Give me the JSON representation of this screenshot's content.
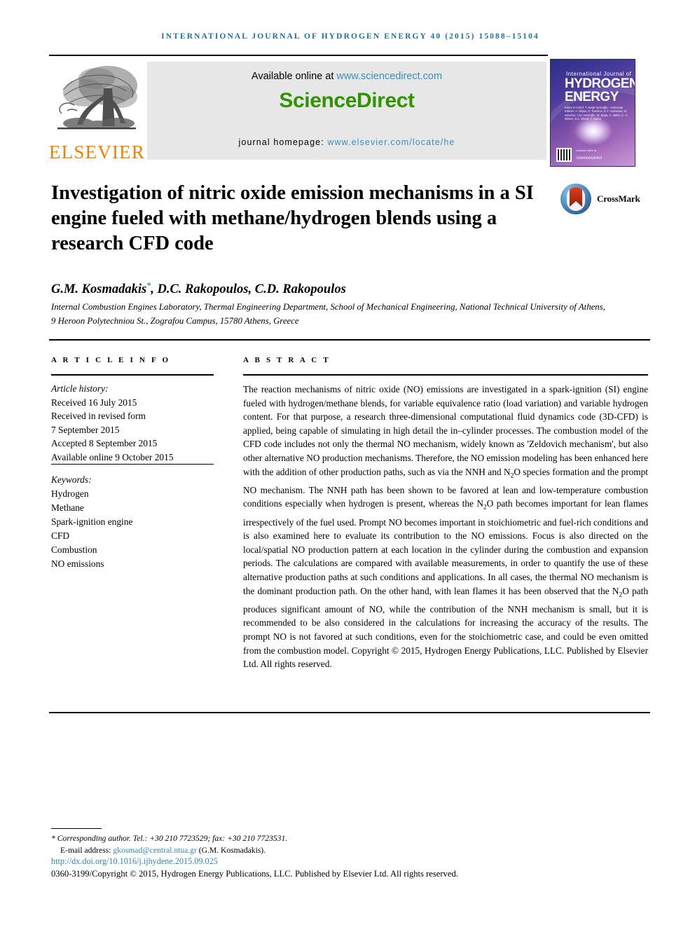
{
  "running_head": "International Journal of Hydrogen Energy 40 (2015) 15088–15104",
  "masthead": {
    "publisher_wordmark": "ELSEVIER",
    "available_prefix": "Available online at ",
    "available_link": "www.sciencedirect.com",
    "sciencedirect_wordmark": "ScienceDirect",
    "homepage_prefix": "journal homepage: ",
    "homepage_link": "www.elsevier.com/locate/he",
    "cover": {
      "line_small": "International Journal of",
      "line_big_1": "HYDROGEN",
      "line_big_2": "ENERGY",
      "editors": "Editor-in-Chief: T. Nejat Veziroğlu · Associate Editors: A. Bejan, D. Dunikov, D.Y. Goswami, M. Hirscher, T.N. Veziroğlu, M. Balat, A. Züttel, C.-J. Winter, S.A. Sherif, F. Barbir"
    }
  },
  "article": {
    "title": "Investigation of nitric oxide emission mechanisms in a SI engine fueled with methane/hydrogen blends using a research CFD code",
    "crossmark_label": "CrossMark",
    "authors": "G.M. Kosmadakis*, D.C. Rakopoulos, C.D. Rakopoulos",
    "affiliation": "Internal Combustion Engines Laboratory, Thermal Engineering Department, School of Mechanical Engineering, National Technical University of Athens, 9 Heroon Polytechniou St., Zografou Campus, 15780 Athens, Greece"
  },
  "article_info": {
    "heading": "A R T I C L E   I N F O",
    "history_label": "Article history:",
    "history": [
      "Received 16 July 2015",
      "Received in revised form",
      "7 September 2015",
      "Accepted 8 September 2015",
      "Available online 9 October 2015"
    ],
    "keywords_label": "Keywords:",
    "keywords": [
      "Hydrogen",
      "Methane",
      "Spark-ignition engine",
      "CFD",
      "Combustion",
      "NO emissions"
    ]
  },
  "abstract": {
    "heading": "A B S T R A C T",
    "paragraphs": [
      "The reaction mechanisms of nitric oxide (NO) emissions are investigated in a spark-ignition (SI) engine fueled with hydrogen/methane blends, for variable equivalence ratio (load variation) and variable hydrogen content. For that purpose, a research three-dimensional computational fluid dynamics code (3D-CFD) is applied, being capable of simulating in high detail the in–cylinder processes. The combustion model of the CFD code includes not only the thermal NO mechanism, widely known as 'Zeldovich mechanism', but also other alternative NO production mechanisms. Therefore, the NO emission modeling has been enhanced here with the addition of other production paths, such as via the NNH and N2O species formation and the prompt NO mechanism. The NNH path has been shown to be favored at lean and low-temperature combustion conditions especially when hydrogen is present, whereas the N2O path becomes important for lean flames irrespectively of the fuel used. Prompt NO becomes important in stoichiometric and fuel-rich conditions and is also examined here to evaluate its contribution to the NO emissions. Focus is also directed on the local/spatial NO production pattern at each location in the cylinder during the combustion and expansion periods. The calculations are compared with available measurements, in order to quantify the use of these alternative production paths at such conditions and applications. In all cases, the thermal NO mechanism is the dominant production path. On the other hand, with lean flames it has been observed that the N2O path produces significant amount of NO, while the contribution of the NNH mechanism is small, but it is recommended to be also considered in the calculations for increasing the accuracy of the results. The prompt NO is not favored at such conditions, even for the stoichiometric case, and could be even omitted from the combustion model.",
      "Copyright © 2015, Hydrogen Energy Publications, LLC. Published by Elsevier Ltd. All rights reserved."
    ]
  },
  "footer": {
    "corresponding_author": "* Corresponding author. Tel.: +30 210 7723529; fax: +30 210 7723531.",
    "email_label": "E-mail address: ",
    "email": "gkosmad@central.ntua.gr",
    "email_suffix": " (G.M. Kosmadakis).",
    "doi": "http://dx.doi.org/10.1016/j.ijhydene.2015.09.025",
    "copyright": "0360-3199/Copyright © 2015, Hydrogen Energy Publications, LLC. Published by Elsevier Ltd. All rights reserved."
  },
  "colors": {
    "link": "#2f87b7",
    "running_head": "#1f6f9e",
    "sciencedirect_green": "#2f9400",
    "elsevier_orange": "#f08000"
  }
}
